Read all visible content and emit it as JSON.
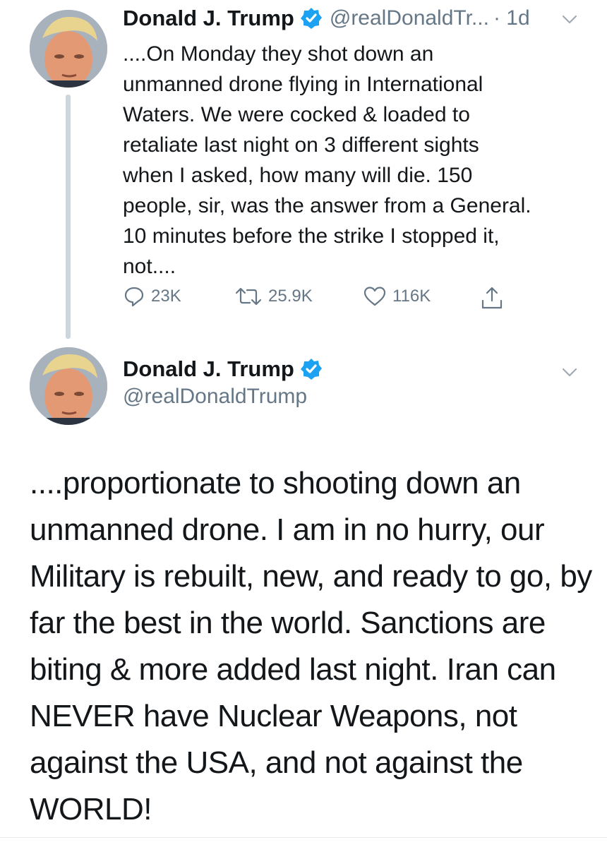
{
  "tweet1": {
    "display_name": "Donald J. Trump",
    "handle": "@realDonaldTr...",
    "time": "· 1d",
    "text": "....On Monday they shot down an\nunmanned drone flying in International\nWaters. We were cocked & loaded to\nretaliate last night on 3 different sights\nwhen I asked, how many will die. 150\npeople, sir, was the answer from a General.\n10 minutes before the strike I stopped it,\nnot....",
    "actions": {
      "replies": "23K",
      "retweets": "25.9K",
      "likes": "116K"
    }
  },
  "tweet2": {
    "display_name": "Donald J. Trump",
    "handle": "@realDonaldTrump",
    "text": "....proportionate to shooting down an unmanned drone. I am in no hurry, our Military is rebuilt, new,  and ready to go, by far the best in the world. Sanctions are biting & more added last night. Iran can NEVER have Nuclear Weapons, not against the USA, and not against the WORLD!"
  },
  "colors": {
    "verified": "#1da1f2",
    "secondary_text": "#657786",
    "thread_line": "#ccd6dd"
  },
  "icons": [
    "avatar",
    "verified-badge-icon",
    "chevron-down-icon",
    "reply-icon",
    "retweet-icon",
    "like-icon",
    "share-icon"
  ]
}
